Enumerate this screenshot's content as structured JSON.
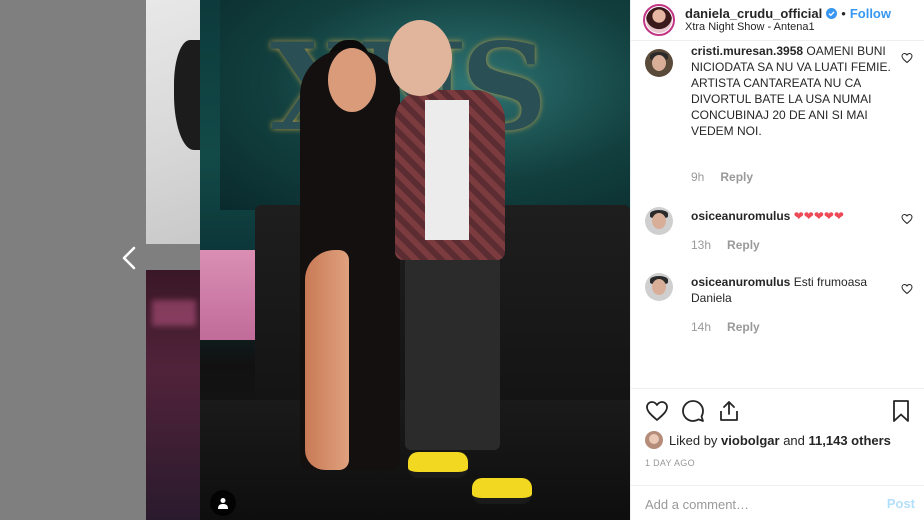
{
  "header": {
    "username": "daniela_crudu_official",
    "separator": "•",
    "follow_label": "Follow",
    "location": "Xtra Night Show - Antena1"
  },
  "photo": {
    "screen_logo": "XNS"
  },
  "comments": [
    {
      "user": "cristi.muresan.3958",
      "text": "OAMENI BUNI NICIODATA SA NU VA LUATI FEMIE. ARTISTA CANTAREATA NU CA DIVORTUL BATE LA USA NUMAI CONCUBINAJ 20 DE ANI SI MAI VEDEM NOI.",
      "time": "9h",
      "reply_label": "Reply"
    },
    {
      "user": "osiceanuromulus",
      "text": "❤❤❤❤❤",
      "time": "13h",
      "reply_label": "Reply"
    },
    {
      "user": "osiceanuromulus",
      "text": "Esti frumoasa Daniela",
      "time": "14h",
      "reply_label": "Reply"
    }
  ],
  "likes": {
    "prefix": "Liked by",
    "user": "viobolgar",
    "middle": "and",
    "count": "11,143 others"
  },
  "timestamp": "1 DAY AGO",
  "add_comment": {
    "placeholder": "Add a comment…",
    "post_label": "Post"
  },
  "colors": {
    "accent_blue": "#3897f0",
    "post_disabled": "#b2dffc",
    "heart_red": "#ed4956"
  },
  "icons": [
    "chevron-left-icon",
    "user-tag-icon",
    "verified-badge-icon",
    "heart-icon",
    "comment-icon",
    "share-icon",
    "bookmark-icon",
    "add-circle-icon"
  ]
}
